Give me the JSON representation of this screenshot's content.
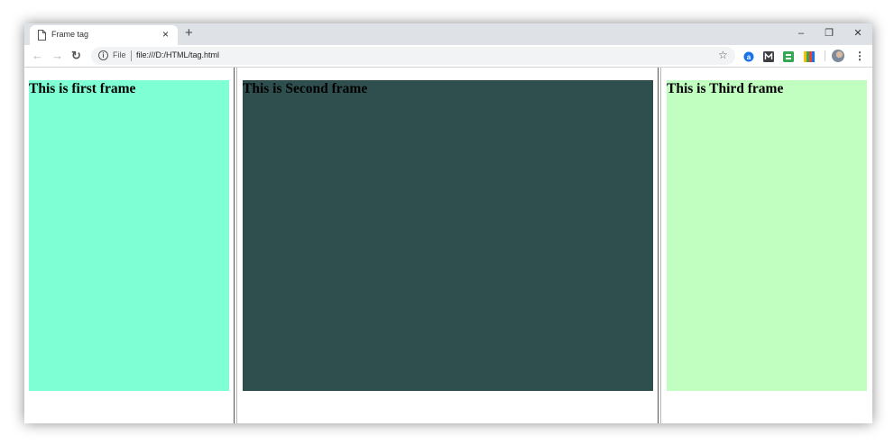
{
  "browser": {
    "tab_title": "Frame tag",
    "tab_close": "×",
    "new_tab": "+",
    "controls": {
      "minimize": "–",
      "restore": "❐",
      "close": "✕"
    }
  },
  "toolbar": {
    "back_icon": "←",
    "forward_icon": "→",
    "reload_icon": "↻",
    "scheme_label": "File",
    "url": "file:///D:/HTML/tag.html",
    "star_icon": "☆",
    "menu_icon": "⋮",
    "extensions": [
      {
        "name": "a-extension-icon",
        "color": "#1a73e8"
      },
      {
        "name": "m-extension-icon",
        "color": "#3c4043"
      },
      {
        "name": "green-extension-icon",
        "color": "#34a853"
      },
      {
        "name": "colorbars-extension-icon",
        "color": "#fbbc04"
      }
    ]
  },
  "frames": [
    {
      "heading": "This is first frame",
      "bg": "#7fffd4"
    },
    {
      "heading": "This is Second frame",
      "bg": "#2f4f4f"
    },
    {
      "heading": "This is Third frame",
      "bg": "#c1ffc1"
    }
  ]
}
